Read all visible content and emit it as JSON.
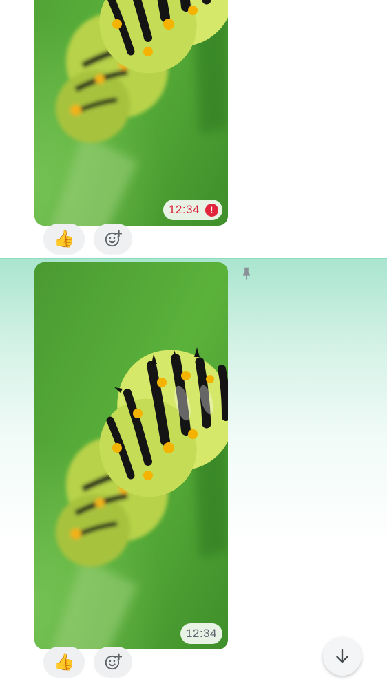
{
  "messages": [
    {
      "time": "12:34",
      "status": "error",
      "reactions": {
        "like_emoji": "👍"
      }
    },
    {
      "time": "12:34",
      "status": "sent",
      "pinned": true,
      "reactions": {
        "like_emoji": "👍"
      }
    }
  ],
  "icons": {
    "error": "!",
    "pin": "pin-icon",
    "add_reaction": "add-reaction-icon",
    "scroll_down": "arrow-down-icon"
  },
  "colors": {
    "error": "#e0253c",
    "pinned_bg": "#a9e5cf"
  }
}
